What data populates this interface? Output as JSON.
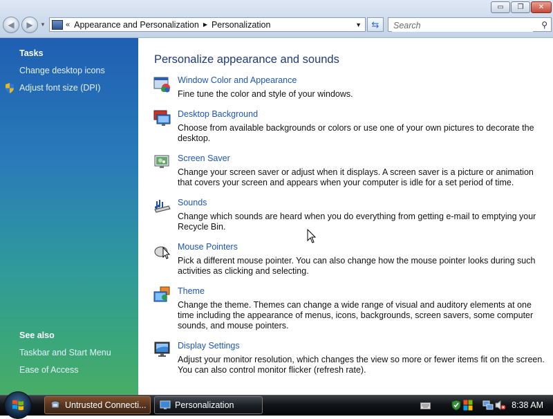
{
  "window": {
    "controls": {
      "minimize": "▭",
      "maximize": "❐",
      "close": "✕"
    }
  },
  "navigation": {
    "back_icon": "back-arrow-icon",
    "forward_icon": "forward-arrow-icon",
    "address": {
      "chevron": "«",
      "crumbs": [
        "Appearance and Personalization",
        "Personalization"
      ]
    },
    "search": {
      "placeholder": "Search"
    }
  },
  "sidebar": {
    "tasks_heading": "Tasks",
    "tasks": [
      {
        "label": "Change desktop icons"
      },
      {
        "label": "Adjust font size (DPI)",
        "icon": "uac-shield-icon"
      }
    ],
    "see_also_heading": "See also",
    "see_also": [
      {
        "label": "Taskbar and Start Menu"
      },
      {
        "label": "Ease of Access"
      }
    ]
  },
  "main": {
    "title": "Personalize appearance and sounds",
    "items": [
      {
        "title": "Window Color and Appearance",
        "description": "Fine tune the color and style of your windows.",
        "icon": "window-color-icon"
      },
      {
        "title": "Desktop Background",
        "description": "Choose from available backgrounds or colors or use one of your own pictures to decorate the desktop.",
        "icon": "desktop-background-icon"
      },
      {
        "title": "Screen Saver",
        "description": "Change your screen saver or adjust when it displays. A screen saver is a picture or animation that covers your screen and appears when your computer is idle for a set period of time.",
        "icon": "screen-saver-icon"
      },
      {
        "title": "Sounds",
        "description": "Change which sounds are heard when you do everything from getting e-mail to emptying your Recycle Bin.",
        "icon": "sounds-icon"
      },
      {
        "title": "Mouse Pointers",
        "description": "Pick a different mouse pointer. You can also change how the mouse pointer looks during such activities as clicking and selecting.",
        "icon": "mouse-pointers-icon"
      },
      {
        "title": "Theme",
        "description": "Change the theme. Themes can change a wide range of visual and auditory elements at one time including the appearance of menus, icons, backgrounds, screen savers, some computer sounds, and mouse pointers.",
        "icon": "theme-icon"
      },
      {
        "title": "Display Settings",
        "description": "Adjust your monitor resolution, which changes the view so more or fewer items fit on the screen. You can also control monitor flicker (refresh rate).",
        "icon": "display-settings-icon"
      }
    ]
  },
  "taskbar": {
    "buttons": [
      {
        "label": "Untrusted Connecti...",
        "icon": "security-warning-icon"
      },
      {
        "label": "Personalization",
        "icon": "personalization-icon"
      }
    ],
    "clock": "8:38 AM"
  }
}
